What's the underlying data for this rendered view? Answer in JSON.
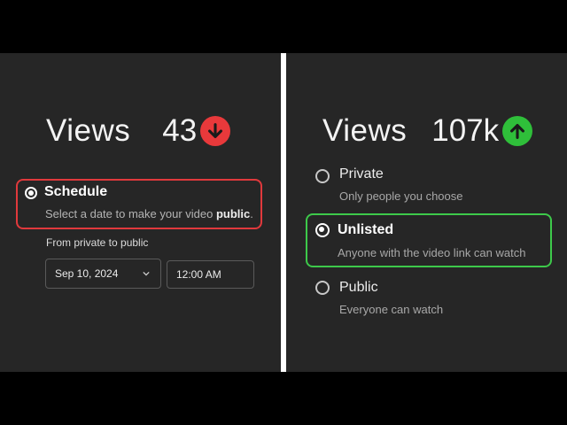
{
  "left": {
    "views_label": "Views",
    "views_count": "43",
    "trend": "down",
    "trend_icon": "arrow-down-icon",
    "trend_color": "#e8393b",
    "schedule_option": {
      "title": "Schedule",
      "subtitle_prefix": "Select a date to make your video ",
      "subtitle_bold": "public",
      "subtitle_suffix": ".",
      "selected": true
    },
    "from_label": "From private to public",
    "date_value": "Sep 10, 2024",
    "time_value": "12:00 AM",
    "highlight_color": "#e0393c"
  },
  "right": {
    "views_label": "Views",
    "views_count": "107k",
    "trend": "up",
    "trend_icon": "arrow-up-icon",
    "trend_color": "#2fbf3a",
    "options": [
      {
        "title": "Private",
        "subtitle": "Only people you choose",
        "selected": false
      },
      {
        "title": "Unlisted",
        "subtitle": "Anyone with the video link can watch",
        "selected": true
      },
      {
        "title": "Public",
        "subtitle": "Everyone can watch",
        "selected": false
      }
    ],
    "highlight_color": "#3dc94a"
  }
}
